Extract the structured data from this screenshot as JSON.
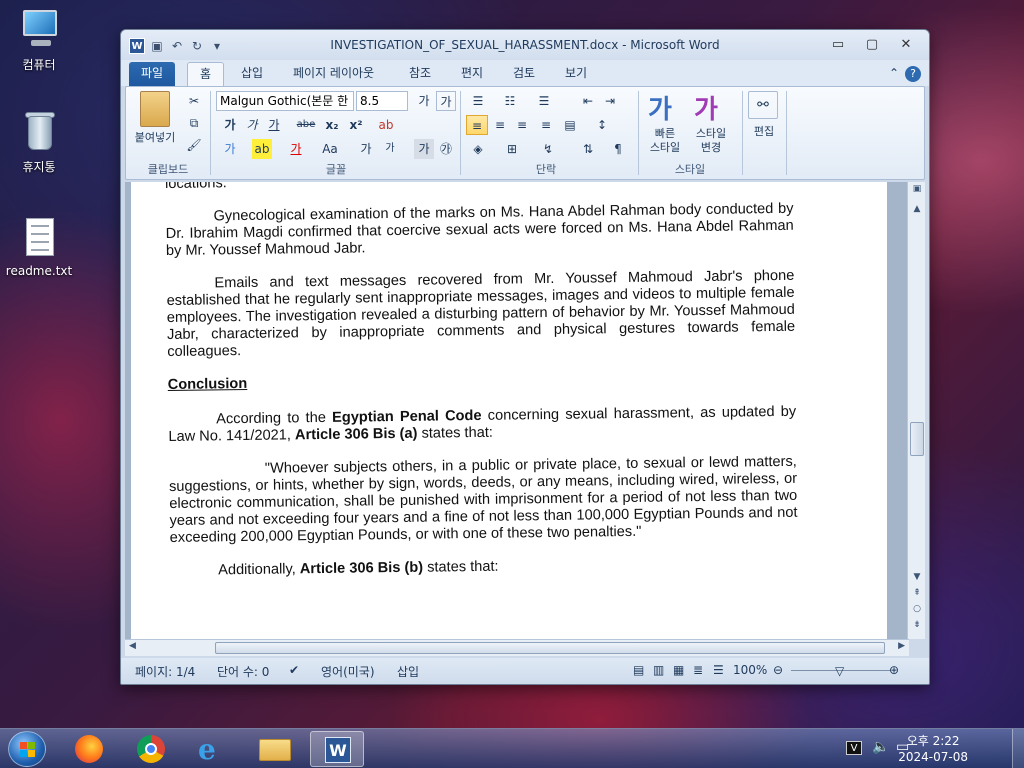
{
  "desktop": {
    "icons": [
      {
        "label": "컴퓨터"
      },
      {
        "label": "휴지통"
      },
      {
        "label": "readme.txt"
      }
    ]
  },
  "window": {
    "title": "INVESTIGATION_OF_SEXUAL_HARASSMENT.docx  -  Microsoft Word",
    "controls": {
      "minimize": "▭",
      "maximize": "▢",
      "close": "✕"
    }
  },
  "ribbon": {
    "tabs": [
      {
        "label": "파일"
      },
      {
        "label": "홈"
      },
      {
        "label": "삽입"
      },
      {
        "label": "페이지 레이아웃"
      },
      {
        "label": "참조"
      },
      {
        "label": "편지"
      },
      {
        "label": "검토"
      },
      {
        "label": "보기"
      }
    ],
    "active_tab": "홈",
    "clipboard": {
      "paste": "붙여넣기",
      "group": "클립보드"
    },
    "font": {
      "name": "Malgun Gothic(본문 한",
      "size": "8.5",
      "group": "글꼴",
      "bold": "가",
      "italic": "가",
      "underline": "가",
      "strike": "abe",
      "subscript": "x₂",
      "superscript": "x²",
      "case": "Aa",
      "grow": "가",
      "shrink": "가"
    },
    "paragraph": {
      "group": "단락"
    },
    "styles": {
      "quick": "빠른\n스타일",
      "change": "스타일\n변경",
      "group": "스타일"
    },
    "editing": {
      "label": "편집"
    }
  },
  "document": {
    "paragraphs": [
      {
        "text": "locations.",
        "style": "plain"
      },
      {
        "text": "Gynecological examination of the marks on Ms. Hana Abdel Rahman body conducted by Dr. Ibrahim Magdi confirmed that coercive sexual acts were forced on Ms. Hana Abdel Rahman by Mr. Youssef Mahmoud Jabr.",
        "style": "indent"
      },
      {
        "text": "Emails and text messages recovered from Mr. Youssef Mahmoud Jabr's phone established that he regularly sent inappropriate messages, images and videos to multiple female employees. The investigation revealed a disturbing pattern of behavior by Mr. Youssef Mahmoud Jabr, characterized by inappropriate comments and physical gestures towards female colleagues.",
        "style": "indent"
      }
    ],
    "heading": "Conclusion",
    "penal_para": {
      "pre": "According to the ",
      "code": "Egyptian Penal Code",
      "mid": " concerning sexual harassment, as updated by Law No. 141/2021, ",
      "article": "Article 306 Bis (a)",
      "post": " states that:"
    },
    "quote": "\"Whoever subjects others, in a public or private place, to sexual or lewd matters, suggestions, or hints, whether by sign, words, deeds, or any means, including wired, wireless, or electronic communication, shall be punished with imprisonment for a period of not less than two years and not exceeding four years and a fine of not less than 100,000 Egyptian Pounds and not exceeding 200,000 Egyptian Pounds, or with one of these two penalties.\"",
    "last_para": {
      "pre": "Additionally, ",
      "article": "Article 306 Bis (b)",
      "post": " states that:"
    }
  },
  "statusbar": {
    "page": "페이지: 1/4",
    "words": "단어 수: 0",
    "language": "영어(미국)",
    "mode": "삽입",
    "zoom": "100%"
  },
  "taskbar": {
    "clock_time": "오후 2:22",
    "clock_date": "2024-07-08"
  }
}
